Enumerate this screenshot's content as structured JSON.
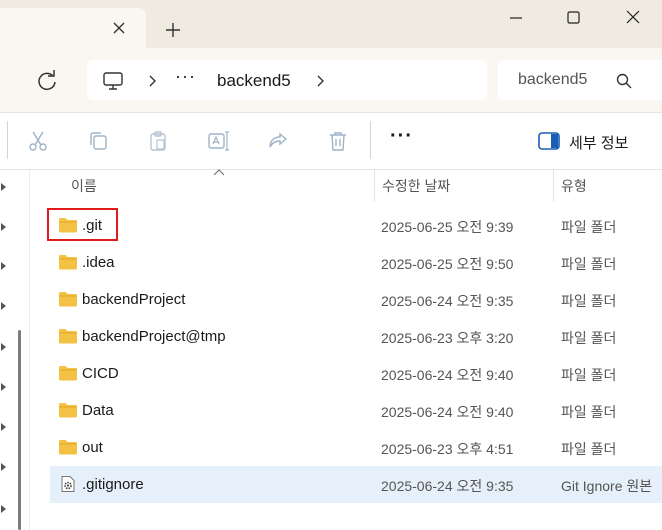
{
  "window": {
    "tab_close_icon": "close-icon",
    "new_tab_icon": "plus-icon",
    "controls": [
      "minimize-icon",
      "maximize-icon",
      "close-icon"
    ]
  },
  "address": {
    "more": "···",
    "current_folder": "backend5"
  },
  "search": {
    "placeholder": "backend5"
  },
  "commands": {
    "more": "···",
    "details_label": "세부 정보"
  },
  "columns": {
    "name": "이름",
    "modified": "수정한 날짜",
    "type": "유형"
  },
  "files": [
    {
      "name": ".git",
      "modified": "2025-06-25 오전 9:39",
      "type": "파일 폴더",
      "icon": "folder-icon"
    },
    {
      "name": ".idea",
      "modified": "2025-06-25 오전 9:50",
      "type": "파일 폴더",
      "icon": "folder-icon"
    },
    {
      "name": "backendProject",
      "modified": "2025-06-24 오전 9:35",
      "type": "파일 폴더",
      "icon": "folder-icon"
    },
    {
      "name": "backendProject@tmp",
      "modified": "2025-06-23 오후 3:20",
      "type": "파일 폴더",
      "icon": "folder-icon"
    },
    {
      "name": "CICD",
      "modified": "2025-06-24 오전 9:40",
      "type": "파일 폴더",
      "icon": "folder-icon"
    },
    {
      "name": "Data",
      "modified": "2025-06-24 오전 9:40",
      "type": "파일 폴더",
      "icon": "folder-icon"
    },
    {
      "name": "out",
      "modified": "2025-06-23 오후 4:51",
      "type": "파일 폴더",
      "icon": "folder-icon"
    },
    {
      "name": ".gitignore",
      "modified": "2025-06-24 오전 9:35",
      "type": "Git Ignore 원본",
      "icon": "settings-file-icon"
    }
  ],
  "colors": {
    "highlight": "#e11b1b",
    "folder": "#f3c244",
    "selected_row": "#e6f0fa"
  }
}
